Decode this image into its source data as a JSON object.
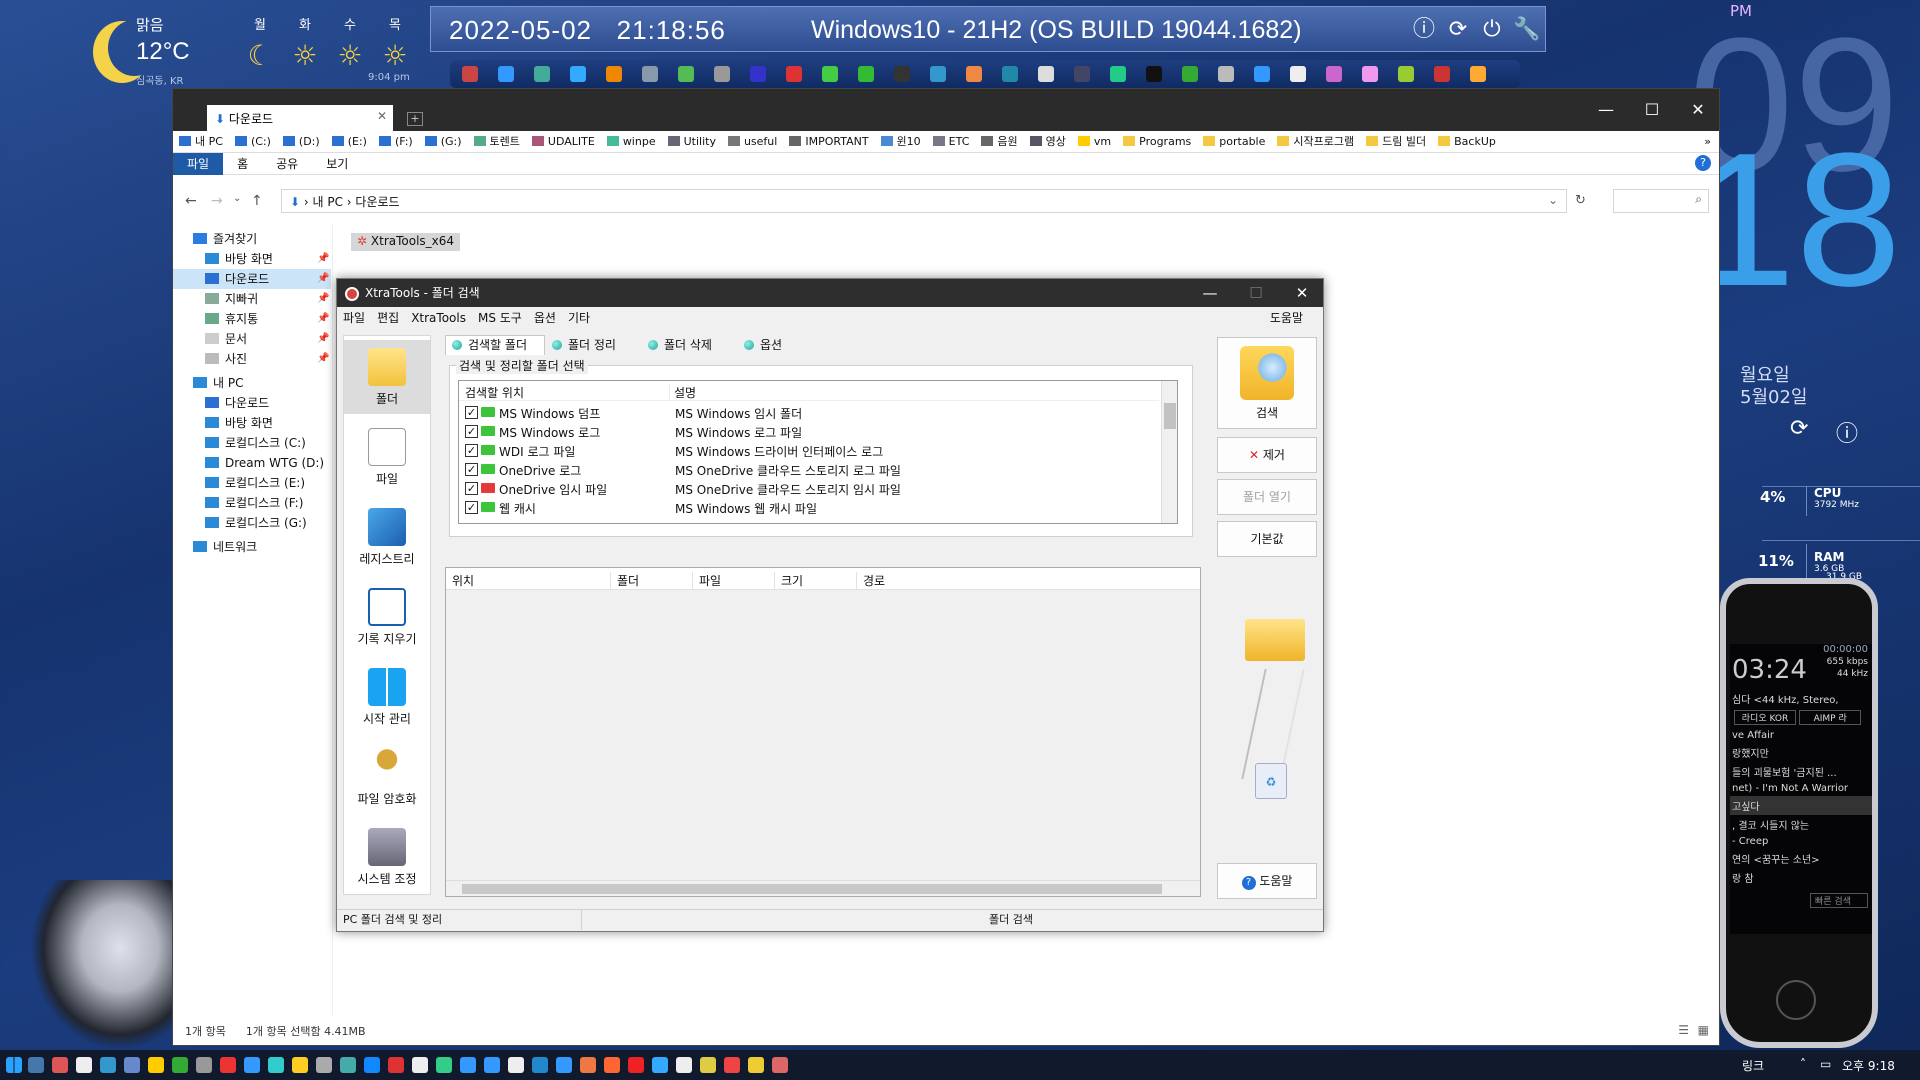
{
  "weather": {
    "condition": "맑음",
    "temp": "12°C",
    "location": "심곡동, KR",
    "forecast": [
      {
        "day": "월",
        "icon": "moon-icon"
      },
      {
        "day": "화",
        "icon": "sun-icon"
      },
      {
        "day": "수",
        "icon": "sun-icon"
      },
      {
        "day": "목",
        "icon": "sun-icon"
      }
    ],
    "time": "9:04 pm"
  },
  "topbar": {
    "date": "2022-05-02",
    "time": "21:18:56",
    "os": "Windows10 - 21H2 (OS BUILD 19044.1682)"
  },
  "clock": {
    "ampm": "PM",
    "hour": "09",
    "minute": "18",
    "weekday": "월요일",
    "date": "5월02일"
  },
  "system": {
    "cpu_label": "CPU",
    "cpu_pct": "4%",
    "cpu_freq": "3792 MHz",
    "ram_label": "RAM",
    "ram_pct": "11%",
    "ram_used": "3.6 GB",
    "ram_total": "31.9 GB"
  },
  "player": {
    "elapsed": "00:00:00",
    "lcd": "03:24",
    "bitrate": "655 kbps",
    "freq": "44 kHz",
    "info": "심다 <44 kHz, Stereo,",
    "btn1": "라디오 KOR",
    "btn2": "AIMP 라",
    "tracks": [
      "ve Affair",
      "랑했지만",
      "들의 괴물보험 '금지된 ...",
      "net) - I'm Not A Warrior",
      "고싶다",
      ", 결코 시들지 않는",
      "- Creep",
      "연의 <꿈꾸는 소년>",
      "랑 참"
    ],
    "search_placeholder": "빠른 검색"
  },
  "explorer": {
    "tab_title": "다운로드",
    "bookmarks": [
      "내 PC",
      "(C:)",
      "(D:)",
      "(E:)",
      "(F:)",
      "(G:)",
      "토렌트",
      "UDALITE",
      "winpe",
      "Utility",
      "useful",
      "IMPORTANT",
      "윈10",
      "ETC",
      "음원",
      "영상",
      "vm",
      "Programs",
      "portable",
      "시작프로그램",
      "드림 빌더",
      "BackUp"
    ],
    "ribbon_tabs": [
      "파일",
      "홈",
      "공유",
      "보기"
    ],
    "breadcrumb": [
      "내 PC",
      "다운로드"
    ],
    "nav_quick": "즐겨찾기",
    "nav_quick_items": [
      "바탕 화면",
      "다운로드",
      "지빠귀",
      "휴지통",
      "문서",
      "사진"
    ],
    "nav_pc": "내 PC",
    "nav_pc_items": [
      "다운로드",
      "바탕 화면",
      "로컬디스크 (C:)",
      "Dream WTG (D:)",
      "로컬디스크 (E:)",
      "로컬디스크 (F:)",
      "로컬디스크 (G:)"
    ],
    "nav_network": "네트워크",
    "file_item": "XtraTools_x64",
    "status_count": "1개 항목",
    "status_selected": "1개 항목 선택함 4.41MB"
  },
  "xtratools": {
    "title": "XtraTools - 폴더 검색",
    "menu": [
      "파일",
      "편집",
      "XtraTools",
      "MS 도구",
      "옵션",
      "기타"
    ],
    "menu_help": "도움말",
    "left_tools": [
      "폴더",
      "파일",
      "레지스트리",
      "기록 지우기",
      "시작 관리",
      "파일 암호화",
      "시스템 조정"
    ],
    "tabs": [
      "검색할 폴더",
      "폴더 정리",
      "폴더 삭제",
      "옵션"
    ],
    "group_label": "검색 및 정리할 폴더 선택",
    "list_headers": [
      "검색할 위치",
      "설명"
    ],
    "list_rows": [
      {
        "name": "MS Windows 덤프",
        "desc": "MS Windows 임시 폴더",
        "color": "#3cc43c"
      },
      {
        "name": "MS Windows 로그",
        "desc": "MS Windows 로그 파일",
        "color": "#3cc43c"
      },
      {
        "name": "WDI 로그 파일",
        "desc": "MS Windows 드라이버 인터페이스 로그",
        "color": "#3cc43c"
      },
      {
        "name": "OneDrive 로그",
        "desc": "MS OneDrive 클라우드 스토리지 로그 파일",
        "color": "#3cc43c"
      },
      {
        "name": "OneDrive 임시 파일",
        "desc": "MS OneDrive 클라우드 스토리지 임시 파일",
        "color": "#e23a3a"
      },
      {
        "name": "웹 캐시",
        "desc": "MS Windows 웹 캐시 파일",
        "color": "#3cc43c"
      }
    ],
    "result_headers": [
      "위치",
      "폴더",
      "파일",
      "크기",
      "경로"
    ],
    "buttons": {
      "search": "검색",
      "remove": "제거",
      "open": "폴더 열기",
      "default": "기본값",
      "help": "도움말"
    },
    "status_left": "PC 폴더 검색 및 정리",
    "status_right": "폴더 검색"
  },
  "taskbar": {
    "tray_label": "링크",
    "time": "오후 9:18"
  }
}
